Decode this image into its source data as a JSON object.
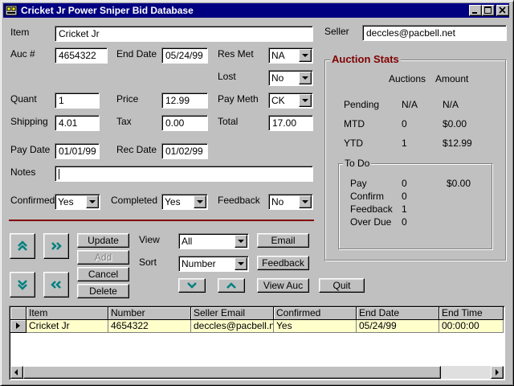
{
  "window": {
    "title": "Cricket Jr Power Sniper Bid Database"
  },
  "form": {
    "item_label": "Item",
    "item_value": "Cricket Jr",
    "seller_label": "Seller",
    "seller_value": "deccles@pacbell.net",
    "auc_label": "Auc #",
    "auc_value": "4654322",
    "enddate_label": "End Date",
    "enddate_value": "05/24/99",
    "resmet_label": "Res Met",
    "resmet_value": "NA",
    "lost_label": "Lost",
    "lost_value": "No",
    "quant_label": "Quant",
    "quant_value": "1",
    "price_label": "Price",
    "price_value": "12.99",
    "paymeth_label": "Pay Meth",
    "paymeth_value": "CK",
    "shipping_label": "Shipping",
    "shipping_value": "4.01",
    "tax_label": "Tax",
    "tax_value": "0.00",
    "total_label": "Total",
    "total_value": "17.00",
    "paydate_label": "Pay Date",
    "paydate_value": "01/01/99",
    "recdate_label": "Rec Date",
    "recdate_value": "01/02/99",
    "notes_label": "Notes",
    "notes_value": "",
    "confirmed_label": "Confirmed",
    "confirmed_value": "Yes",
    "completed_label": "Completed",
    "completed_value": "Yes",
    "feedback_label": "Feedback",
    "feedback_value": "No"
  },
  "controls": {
    "update": "Update",
    "add": "Add",
    "cancel": "Cancel",
    "delete": "Delete",
    "view_label": "View",
    "view_value": "All",
    "sort_label": "Sort",
    "sort_value": "Number",
    "email": "Email",
    "feedback": "Feedback",
    "view_auc": "View Auc",
    "quit": "Quit"
  },
  "stats": {
    "title": "Auction Stats",
    "col_auctions": "Auctions",
    "col_amount": "Amount",
    "rows": [
      {
        "label": "Pending",
        "auctions": "N/A",
        "amount": "N/A"
      },
      {
        "label": "MTD",
        "auctions": "0",
        "amount": "$0.00"
      },
      {
        "label": "YTD",
        "auctions": "1",
        "amount": "$12.99"
      }
    ],
    "todo": {
      "title": "To Do",
      "rows": [
        {
          "label": "Pay",
          "count": "0",
          "amount": "$0.00"
        },
        {
          "label": "Confirm",
          "count": "0",
          "amount": ""
        },
        {
          "label": "Feedback",
          "count": "1",
          "amount": ""
        },
        {
          "label": "Over Due",
          "count": "0",
          "amount": ""
        }
      ]
    }
  },
  "grid": {
    "columns": [
      "Item",
      "Number",
      "Seller Email",
      "Confirmed",
      "End Date",
      "End Time"
    ],
    "rows": [
      [
        "Cricket Jr",
        "4654322",
        "deccles@pacbell.ne",
        "Yes",
        "05/24/99",
        "00:00:00"
      ]
    ]
  },
  "colors": {
    "title_bg": "#000080",
    "accent": "#800000",
    "face": "#c0c0c0",
    "selected_row": "#ffffcc"
  }
}
